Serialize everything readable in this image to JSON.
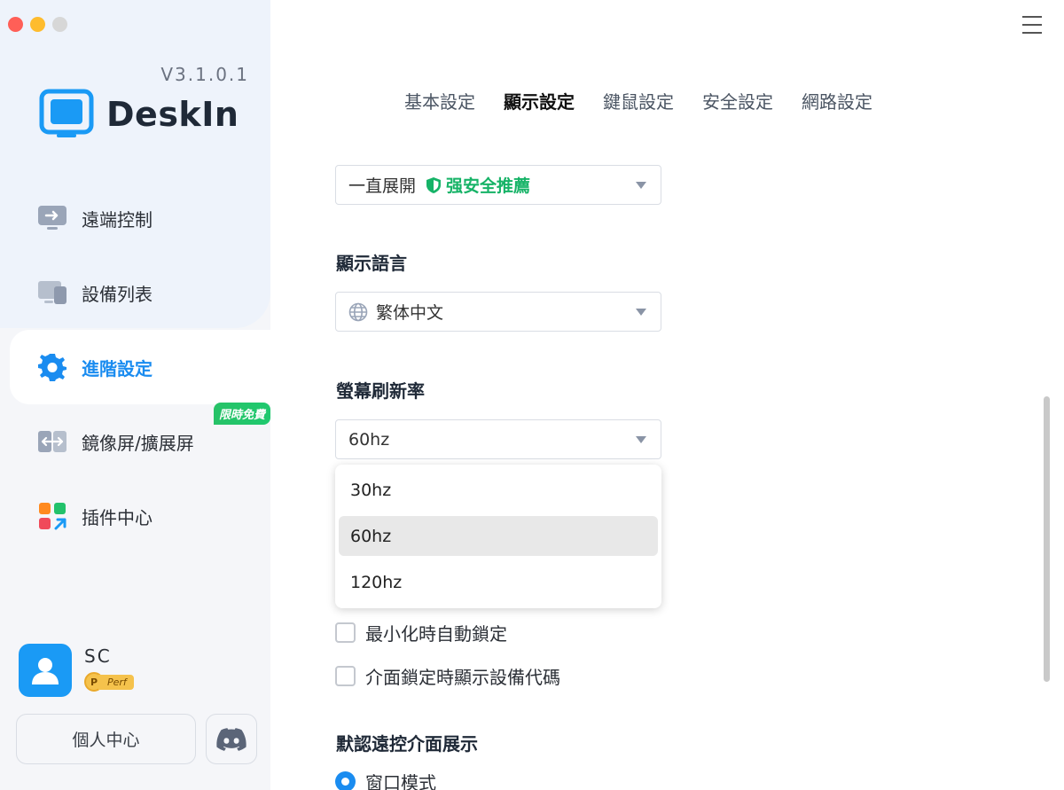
{
  "app": {
    "version": "V3.1.0.1",
    "brand": "DeskIn",
    "accent_color": "#1a8cf0"
  },
  "sidebar": {
    "items": [
      {
        "label": "遠端控制",
        "icon": "remote-control-icon",
        "active": false
      },
      {
        "label": "設備列表",
        "icon": "device-list-icon",
        "active": false
      },
      {
        "label": "進階設定",
        "icon": "gear-icon",
        "active": true
      },
      {
        "label": "鏡像屏/擴展屏",
        "icon": "mirror-screen-icon",
        "active": false,
        "badge": "限時免費"
      },
      {
        "label": "插件中心",
        "icon": "plugin-icon",
        "active": false
      }
    ],
    "user": {
      "name": "SC",
      "tier_letter": "P",
      "tier_label": "Perf"
    },
    "personal_button": "個人中心",
    "discord_icon": "discord-icon"
  },
  "tabs": [
    {
      "label": "基本設定",
      "active": false
    },
    {
      "label": "顯示設定",
      "active": true
    },
    {
      "label": "鍵鼠設定",
      "active": false
    },
    {
      "label": "安全設定",
      "active": false
    },
    {
      "label": "網路設定",
      "active": false
    }
  ],
  "settings": {
    "toolbar_mode": {
      "value": "一直展開",
      "recommend": "强安全推薦"
    },
    "language": {
      "label": "顯示語言",
      "value": "繁体中文"
    },
    "refresh_rate": {
      "label": "螢幕刷新率",
      "value": "60hz",
      "options": [
        "30hz",
        "60hz",
        "120hz"
      ],
      "selected": "60hz"
    },
    "checkboxes": [
      {
        "label": "最小化時自動鎖定",
        "checked": false
      },
      {
        "label": "介面鎖定時顯示設備代碼",
        "checked": false
      }
    ],
    "remote_display": {
      "label": "默認遠控介面展示",
      "option": "窗口模式",
      "selected": true
    }
  }
}
